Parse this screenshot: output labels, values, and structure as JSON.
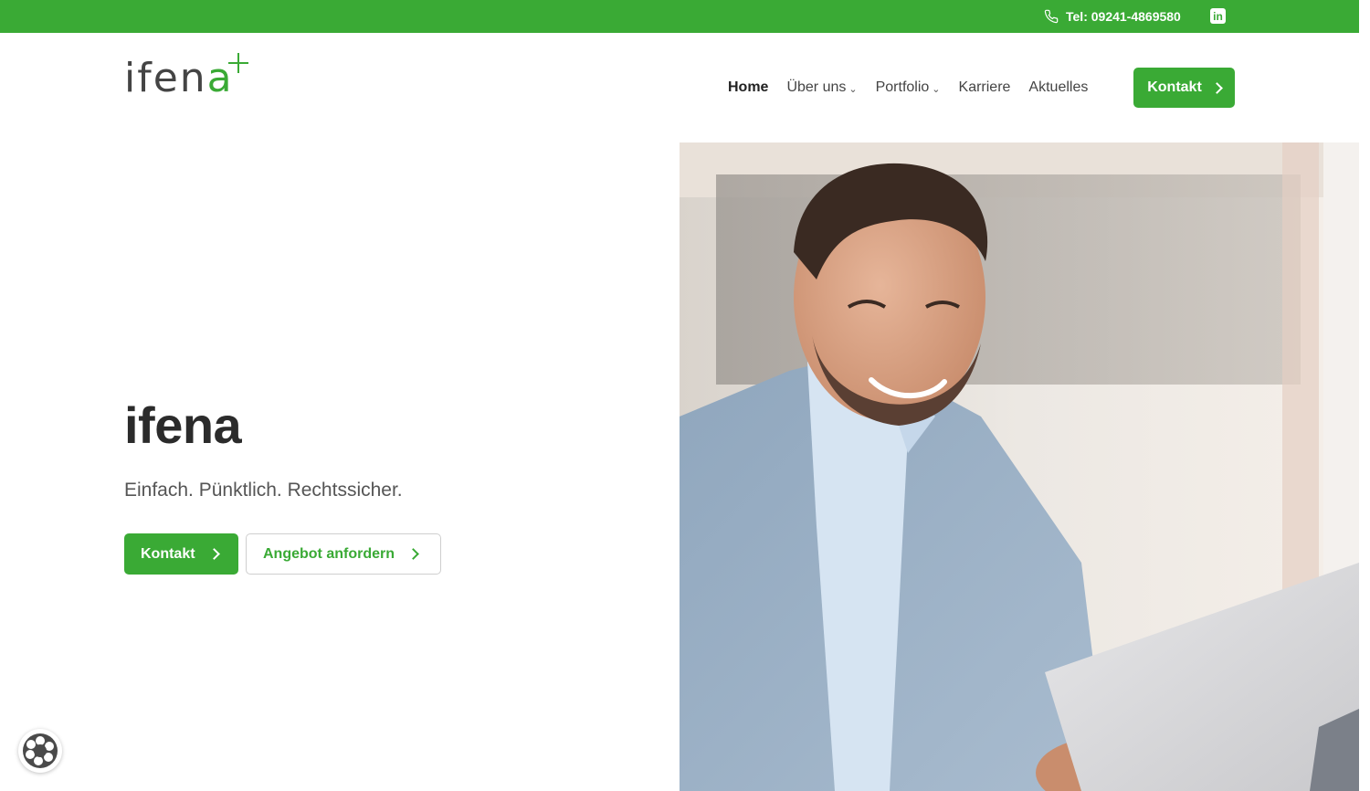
{
  "topbar": {
    "phone_label": "Tel: 09241-4869580",
    "background_color": "#3aaa35",
    "phone_icon": "phone-icon",
    "social_icon": "linkedin-icon",
    "social_glyph": "in"
  },
  "header": {
    "logo_text": "ifen",
    "logo_accent": "a",
    "nav": [
      {
        "label": "Home",
        "active": true,
        "dropdown": false
      },
      {
        "label": "Über uns",
        "active": false,
        "dropdown": true
      },
      {
        "label": "Portfolio",
        "active": false,
        "dropdown": true
      },
      {
        "label": "Karriere",
        "active": false,
        "dropdown": false
      },
      {
        "label": "Aktuelles",
        "active": false,
        "dropdown": false
      }
    ],
    "cta_label": "Kontakt"
  },
  "hero": {
    "title": "ifena",
    "subtitle": "Einfach. Pünktlich. Rechtssicher.",
    "primary_button": "Kontakt",
    "secondary_button": "Angebot anfordern",
    "accent_color": "#3aaa35"
  },
  "floating": {
    "privacy_icon": "cookie-settings-icon"
  }
}
